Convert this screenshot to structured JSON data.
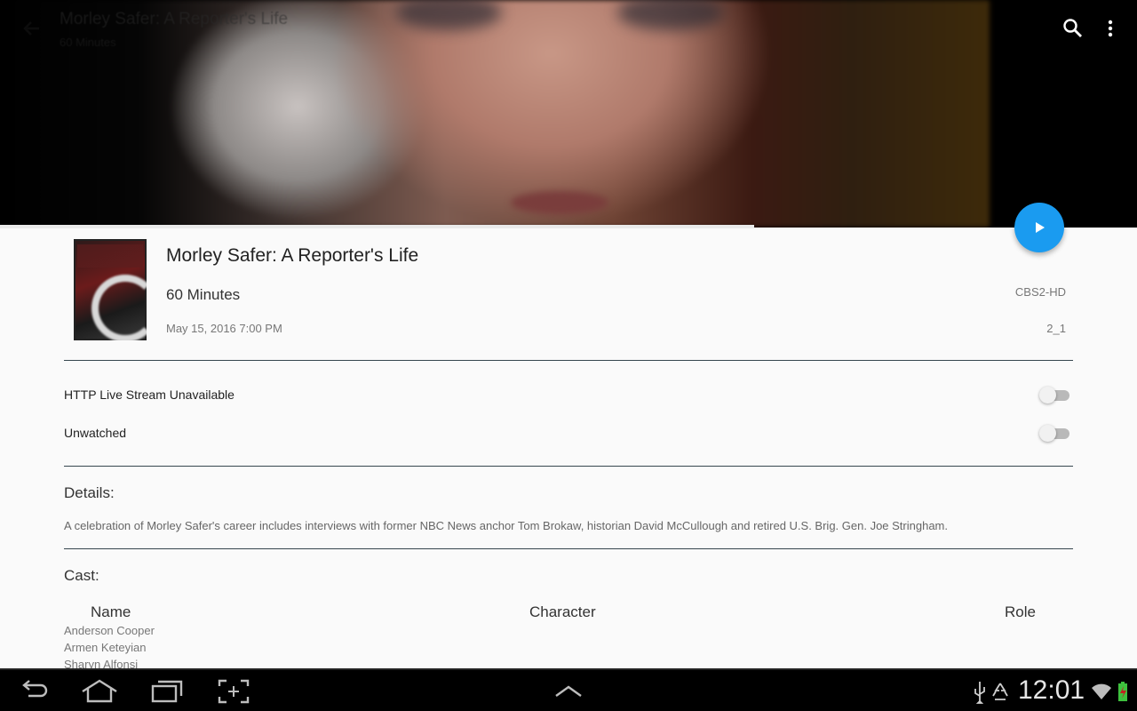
{
  "header": {
    "title": "Morley Safer: A Reporter's Life",
    "subtitle": "60 Minutes"
  },
  "playback": {
    "progress_fraction": 0.663
  },
  "program": {
    "title": "Morley Safer: A Reporter's Life",
    "series": "60 Minutes",
    "airdate": "May 15, 2016 7:00 PM",
    "channel": "CBS2-HD",
    "channel_number": "2_1"
  },
  "toggles": [
    {
      "label": "HTTP Live Stream Unavailable",
      "on": false
    },
    {
      "label": "Unwatched",
      "on": false
    }
  ],
  "details": {
    "heading": "Details:",
    "text": "A celebration of Morley Safer's career includes interviews with former NBC News anchor Tom Brokaw, historian David McCullough and retired U.S. Brig. Gen. Joe Stringham."
  },
  "cast": {
    "heading": "Cast:",
    "columns": [
      "Name",
      "Character",
      "Role"
    ],
    "names": [
      "Anderson Cooper",
      "Armen Keteyian",
      "Sharyn Alfonsi"
    ]
  },
  "system_bar": {
    "time": "12:01",
    "icons": [
      "back-icon",
      "home-icon",
      "recent-apps-icon",
      "screenshot-icon",
      "up-chevron-icon",
      "usb-icon",
      "recycle-icon",
      "wifi-icon",
      "battery-charging-icon"
    ]
  },
  "colors": {
    "accent": "#1a9bf0",
    "divider": "#37474f",
    "background": "#fafafa"
  }
}
